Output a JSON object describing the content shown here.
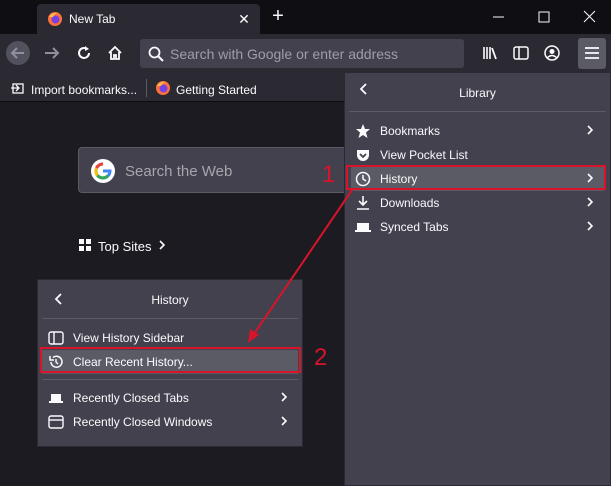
{
  "tab": {
    "title": "New Tab"
  },
  "toolbar": {
    "url_placeholder": "Search with Google or enter address"
  },
  "bookmarks": [
    {
      "label": "Import bookmarks...",
      "icon": "import-icon"
    },
    {
      "label": "Getting Started",
      "icon": "firefox-icon"
    }
  ],
  "content": {
    "search_placeholder": "Search the Web",
    "top_sites_label": "Top Sites"
  },
  "library_panel": {
    "title": "Library",
    "items": [
      {
        "label": "Bookmarks",
        "icon": "star-icon",
        "submenu": true
      },
      {
        "label": "View Pocket List",
        "icon": "pocket-icon",
        "submenu": false
      },
      {
        "label": "History",
        "icon": "clock-icon",
        "submenu": true
      },
      {
        "label": "Downloads",
        "icon": "download-icon",
        "submenu": true
      },
      {
        "label": "Synced Tabs",
        "icon": "synced-tabs-icon",
        "submenu": true
      }
    ]
  },
  "history_panel": {
    "title": "History",
    "items": [
      {
        "label": "View History Sidebar",
        "icon": "sidebar-icon"
      },
      {
        "label": "Clear Recent History...",
        "icon": "history-clear-icon"
      },
      {
        "label": "Recently Closed Tabs",
        "icon": "laptop-icon"
      },
      {
        "label": "Recently Closed Windows",
        "icon": "window-icon"
      }
    ]
  },
  "annotations": {
    "step1": "1",
    "step2": "2",
    "color": "#d7142a"
  }
}
